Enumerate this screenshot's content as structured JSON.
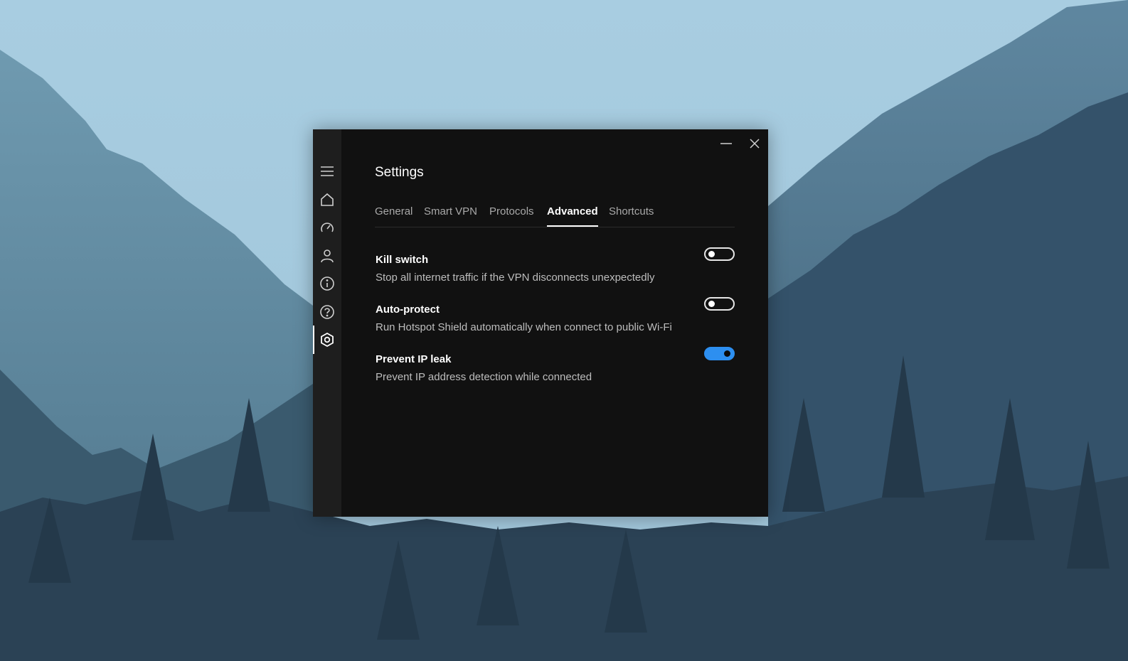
{
  "window": {
    "title": "Settings",
    "minimize_label": "—",
    "close_label": "✕"
  },
  "sidebar": {
    "items": [
      {
        "name": "menu",
        "icon": "hamburger-icon"
      },
      {
        "name": "home",
        "icon": "home-icon"
      },
      {
        "name": "speed",
        "icon": "speedometer-icon"
      },
      {
        "name": "account",
        "icon": "user-icon"
      },
      {
        "name": "info",
        "icon": "info-icon"
      },
      {
        "name": "help",
        "icon": "help-icon"
      },
      {
        "name": "settings",
        "icon": "settings-icon",
        "active": true
      }
    ]
  },
  "tabs": [
    {
      "label": "General",
      "active": false
    },
    {
      "label": "Smart VPN",
      "active": false
    },
    {
      "label": "Protocols",
      "active": false
    },
    {
      "label": "Advanced",
      "active": true
    },
    {
      "label": "Shortcuts",
      "active": false
    }
  ],
  "settings": [
    {
      "title": "Kill switch",
      "description": "Stop all internet traffic if the VPN disconnects unexpectedly",
      "enabled": false
    },
    {
      "title": "Auto-protect",
      "description": "Run Hotspot Shield automatically when connect to public Wi-Fi",
      "enabled": false
    },
    {
      "title": "Prevent IP leak",
      "description": "Prevent IP address detection while connected",
      "enabled": true
    }
  ],
  "colors": {
    "accent": "#2d8ff0",
    "window_bg": "#111111",
    "sidebar_bg": "#1e1e1e"
  }
}
